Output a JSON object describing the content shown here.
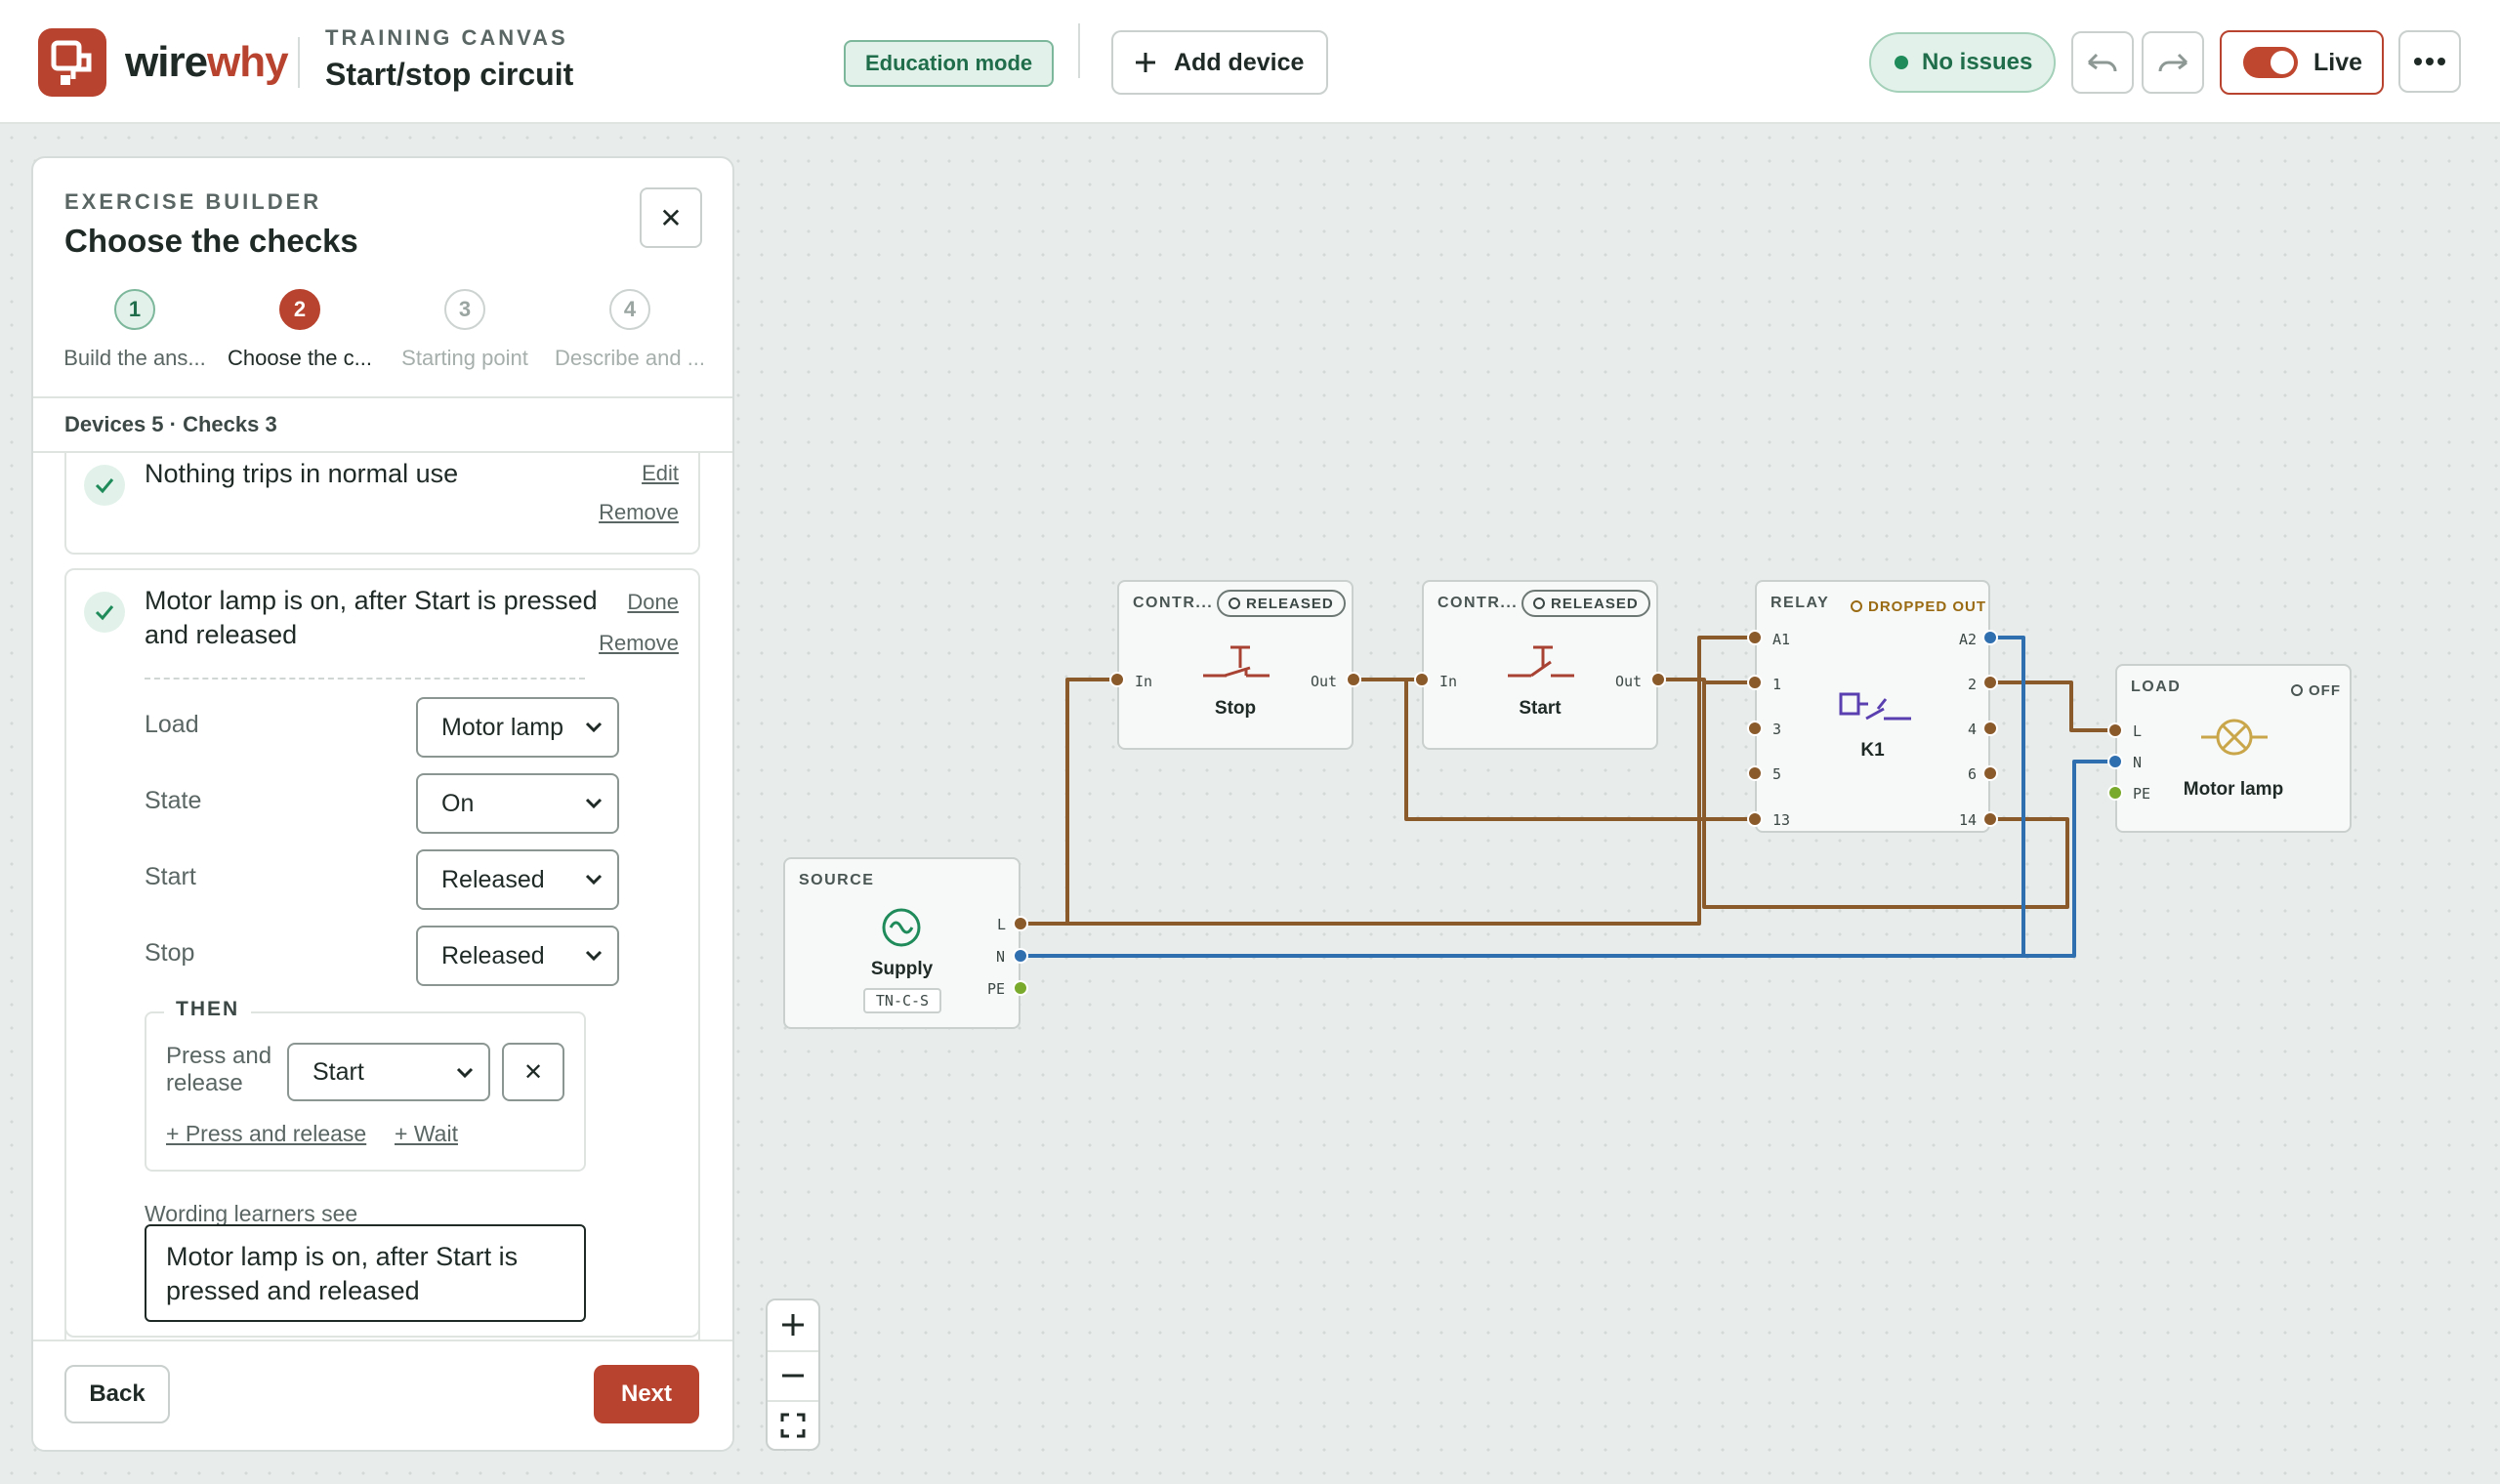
{
  "app": {
    "brand_part1": "wire",
    "brand_part2": "why",
    "eyebrow": "TRAINING CANVAS",
    "title": "Start/stop circuit"
  },
  "header": {
    "mode_badge": "Education mode",
    "add_device": "Add device",
    "status": "No issues",
    "live_label": "Live",
    "live_on": true
  },
  "colors": {
    "accent": "#b8432e",
    "ok": "#1f8a5a",
    "wire_line": "#8a5a2b",
    "wire_neutral": "#2f6fb0",
    "wire_pe": "#7aaa2c"
  },
  "panel": {
    "eyebrow": "EXERCISE BUILDER",
    "title": "Choose the checks",
    "close_icon": "close-icon",
    "steps": [
      {
        "num": "1",
        "label": "Build the ans...",
        "state": "done"
      },
      {
        "num": "2",
        "label": "Choose the c...",
        "state": "current"
      },
      {
        "num": "3",
        "label": "Starting point",
        "state": "todo"
      },
      {
        "num": "4",
        "label": "Describe and ...",
        "state": "todo"
      }
    ],
    "summary": "Devices 5 · Checks 3",
    "check1": {
      "text": "Nothing trips in normal use",
      "edit": "Edit",
      "remove": "Remove"
    },
    "check2": {
      "text_line1": "Motor lamp is on, after Start is pressed",
      "text_line2": "and released",
      "done": "Done",
      "remove": "Remove",
      "fields": [
        {
          "label": "Load",
          "value": "Motor lamp"
        },
        {
          "label": "State",
          "value": "On"
        },
        {
          "label": "Start",
          "value": "Released"
        },
        {
          "label": "Stop",
          "value": "Released"
        }
      ],
      "then_label": "THEN",
      "then_action_line1": "Press and",
      "then_action_line2": "release",
      "then_target": "Start",
      "add_press": "+ Press and release",
      "add_wait": "+ Wait",
      "wording_label": "Wording learners see",
      "wording": "Motor lamp is on, after Start is pressed and released"
    },
    "back": "Back",
    "next": "Next"
  },
  "devices": {
    "stop": {
      "tag": "CONTR...",
      "state": "RELEASED",
      "name": "Stop",
      "in": "In",
      "out": "Out"
    },
    "start": {
      "tag": "CONTR...",
      "state": "RELEASED",
      "name": "Start",
      "in": "In",
      "out": "Out"
    },
    "relay": {
      "tag": "RELAY",
      "state": "DROPPED OUT",
      "name": "K1",
      "left_terms": [
        "A1",
        "1",
        "3",
        "5",
        "13"
      ],
      "right_terms": [
        "A2",
        "2",
        "4",
        "6",
        "14"
      ]
    },
    "load": {
      "tag": "LOAD",
      "state": "OFF",
      "name": "Motor lamp",
      "terms": [
        "L",
        "N",
        "PE"
      ]
    },
    "source": {
      "tag": "SOURCE",
      "name": "Supply",
      "code": "TN-C-S",
      "terms": [
        "L",
        "N",
        "PE"
      ]
    }
  }
}
